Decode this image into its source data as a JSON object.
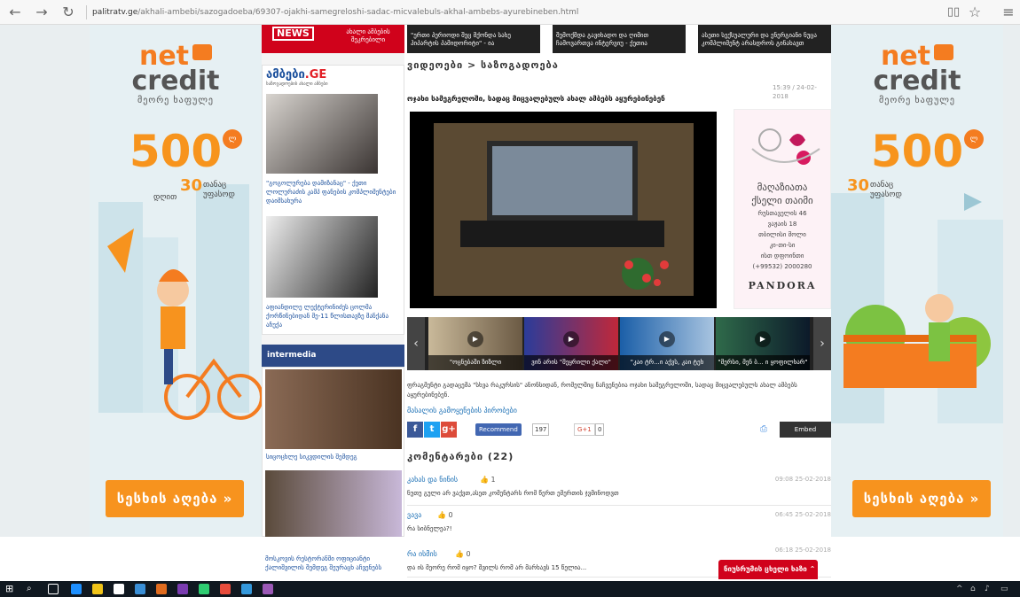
{
  "browser": {
    "url_domain": "palitratv.ge",
    "url_path": "/akhali-ambebi/sazogadoeba/69307-ojakhi-samegreloshi-sadac-micvalebuls-akhal-ambebs-ayurebineben.html"
  },
  "ad": {
    "logo_net": "net",
    "logo_credit": "credit",
    "slogan": "მეორე ხაფულე",
    "big_number": "500",
    "badge": "ლ",
    "days_number": "30",
    "days_line1": "თანაც",
    "days_line2": "დღით",
    "days_line3": "უფასოდ",
    "cta": "სესხის აღება »"
  },
  "breaking": {
    "badge": "NEWS",
    "text": "ახალი ამბების შეკრებილი"
  },
  "ambebi": {
    "logo_main": "ამბები",
    "logo_tld": ".GE",
    "logo_sub": "საზოგადოების ახალი ამბები",
    "items": [
      {
        "caption": "\"გოგოლურება დამიზანაც\" - ქეთი ლოლურაძის კამპ ფანების კომპლიმენტები დაიმსახურა"
      },
      {
        "caption": "აფიანდილე ლექტერინიძეს ცოლმა ქორწინებიდან მე-11 წლისთავზე მანქანა აჩუქა"
      }
    ]
  },
  "intermedia": {
    "logo": "intermedia",
    "items": [
      {
        "caption": "სიცოცხლე სიკვდილის შემდეგ"
      },
      {
        "caption": "მოსკოვის რესტორანში ოფიციანტი ქალიშვილის შემდეგ შეურაცხ აჩვენებს"
      }
    ]
  },
  "top_strip": [
    "\"ერთი პერიოდი შეც მქონდა სახე ჰიპარტის პამიდორიტი\" - ია",
    "შემოქმდა გავიხადო და ღიმით ჩამოვართვა ინტერვიუ - ქეთია",
    "ასეთი სექსუალური და ენერგიანი ნუცა კომპლიმენტ არასდროს გინახავთ"
  ],
  "article": {
    "breadcrumb": "ვიდეოები > საზოგადოება",
    "timestamp": "15:39 / 24-02-2018",
    "title": "ოჯახი სამეგრელოში, სადაც მიცვალებულს ახალ ამბებს აყურებინებენ",
    "description": "ფრაგმენტი გადაცემა \"სხვა რაკურსის\" ანონსიდან, რომელშიც ნაჩვენებია ოჯახი სამეგრელოში, სადაც მიცვალებულს ახალ ამბებს აყურებინებენ.",
    "info_link": "მასალის გამოყენების პირობები"
  },
  "pandora": {
    "line1": "მაღაზიათა",
    "line2": "ქსელი თაიმი",
    "line3": "რუსთაველის 46",
    "line4": "ვაჟაის 18",
    "line5": "თბილისი მოლი",
    "line6": "კი-თი-სი",
    "line7": "ისთ დფოინთი",
    "phone": "(+99532) 2000280",
    "brand": "PANDORA"
  },
  "carousel": [
    {
      "caption": "\"ოცნებაში ზიზლი"
    },
    {
      "caption": "ვინ არის \"შეყრილი ქალი\""
    },
    {
      "caption": "\"კაი ტრ...ი აქვს, კაი ტეხ"
    },
    {
      "caption": "\"მერსი, მენ ბ... ი ყოფილხარ\""
    }
  ],
  "share": {
    "fb": "f",
    "tw": "t",
    "gp": "g+",
    "recommend": "Recommend",
    "recommend_count": "197",
    "gplus": "G+1",
    "gplus_count": "0",
    "embed": "Embed"
  },
  "comments": {
    "heading": "კომენტარები (22)",
    "items": [
      {
        "author": "კახას და ნინის",
        "likes": "1",
        "date": "09:08 25-02-2018",
        "text": "ნუთუ გული არ ვაქვთ,ასეთ კომენტარს რომ წერთ ემერთის ჯვმინოდვთ"
      },
      {
        "author": "ვავა",
        "likes": "0",
        "date": "06:45 25-02-2018",
        "text": "რა სიბნელეა?!"
      },
      {
        "author": "რა ისმის",
        "likes": "0",
        "date": "06:18 25-02-2018",
        "text": "და ის მეორე რომ იყო? შვილს რომ არ მარხავს 15 წელია..."
      }
    ]
  },
  "fb_chat": "ნიუსრუმის ცხელი ხაზი",
  "taskbar": {
    "colors": [
      "#1e90ff",
      "#f0c419",
      "#ffffff",
      "#3a8fd6",
      "#e06c1f",
      "#7a3cb0",
      "#2ecc71",
      "#e74c3c",
      "#3498db",
      "#9b59b6"
    ]
  }
}
